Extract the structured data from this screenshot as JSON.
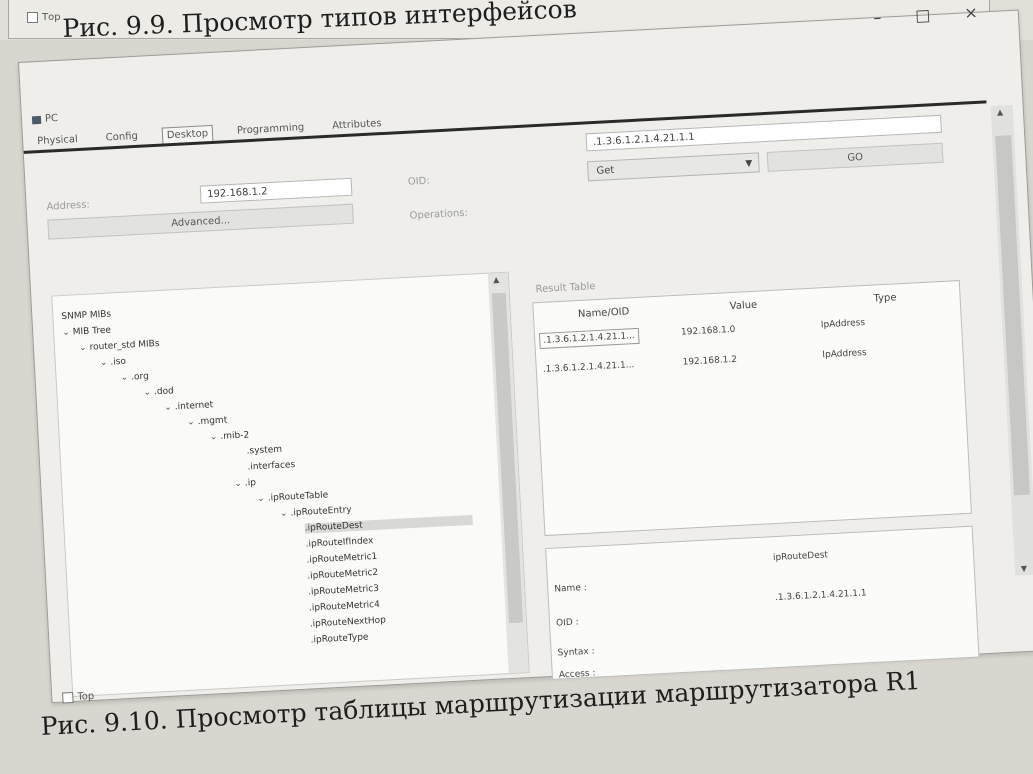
{
  "previous_figure": {
    "checkbox_label": "Тор",
    "caption": "Рис. 9.9. Просмотр типов интерфейсов"
  },
  "window": {
    "title": "PC",
    "controls": {
      "minimize": "–",
      "maximize": "□",
      "close": "×"
    },
    "tabs": [
      "Physical",
      "Config",
      "Desktop",
      "Programming",
      "Attributes"
    ],
    "active_tab": "Desktop",
    "address_label": "Address:",
    "address_value": "192.168.1.2",
    "advanced_button": "Advanced...",
    "oid_label": "OID:",
    "oid_value": ".1.3.6.1.2.1.4.21.1.1",
    "operations_label": "Operations:",
    "operation_value": "Get",
    "go_button": "GO",
    "result_table_label": "Result Table",
    "result_columns": [
      "Name/OID",
      "Value",
      "Type"
    ],
    "result_rows": [
      {
        "name": ".1.3.6.1.2.1.4.21.1...",
        "value": "192.168.1.0",
        "type": "IpAddress"
      },
      {
        "name": ".1.3.6.1.2.1.4.21.1...",
        "value": "192.168.1.2",
        "type": "IpAddress"
      }
    ],
    "detail": {
      "header_value": "ipRouteDest",
      "name_label": "Name :",
      "oid_label": "OID :",
      "oid_value": ".1.3.6.1.2.1.4.21.1.1",
      "syntax_label": "Syntax :",
      "access_label": "Access :"
    },
    "tree": [
      {
        "label": "SNMP MIBs",
        "chev": ""
      },
      {
        "label": "MIB Tree",
        "chev": "⌄"
      },
      {
        "label": "router_std MIBs",
        "chev": "⌄"
      },
      {
        "label": ".iso",
        "chev": "⌄"
      },
      {
        "label": ".org",
        "chev": "⌄"
      },
      {
        "label": ".dod",
        "chev": "⌄"
      },
      {
        "label": ".internet",
        "chev": "⌄"
      },
      {
        "label": ".mgmt",
        "chev": "⌄"
      },
      {
        "label": ".mib-2",
        "chev": "⌄"
      },
      {
        "label": ".system",
        "chev": ""
      },
      {
        "label": ".interfaces",
        "chev": ""
      },
      {
        "label": ".ip",
        "chev": "⌄"
      },
      {
        "label": ".ipRouteTable",
        "chev": "⌄"
      },
      {
        "label": ".ipRouteEntry",
        "chev": "⌄"
      },
      {
        "label": ".ipRouteDest",
        "chev": ""
      },
      {
        "label": ".ipRouteIfIndex",
        "chev": ""
      },
      {
        "label": ".ipRouteMetric1",
        "chev": ""
      },
      {
        "label": ".ipRouteMetric2",
        "chev": ""
      },
      {
        "label": ".ipRouteMetric3",
        "chev": ""
      },
      {
        "label": ".ipRouteMetric4",
        "chev": ""
      },
      {
        "label": ".ipRouteNextHop",
        "chev": ""
      },
      {
        "label": ".ipRouteType",
        "chev": ""
      }
    ],
    "selected_tree_item": ".ipRouteDest",
    "bottom_checkbox_label": "Top"
  },
  "caption": "Рис. 9.10. Просмотр таблицы маршрутизации маршрутизатора R1"
}
